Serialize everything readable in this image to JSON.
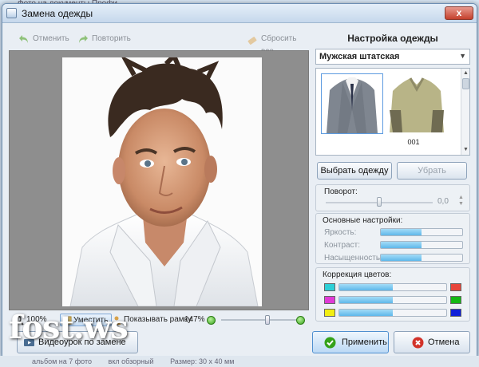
{
  "background": {
    "parent_title": "Фото на документы Профи",
    "status_left": "альбом на 7 фото",
    "status_mid": "вкл обзорный",
    "status_right": "Размер: 30 x 40 мм"
  },
  "dialog": {
    "title": "Замена одежды",
    "close_label": "x"
  },
  "toolbar": {
    "undo_label": "Отменить",
    "redo_label": "Повторить",
    "reset_label": "Сбросить все"
  },
  "zoom": {
    "percent_label": "100%",
    "fit_label": "Уместить",
    "show_frame_label": "Показывать рамку",
    "zoom_value": "147%",
    "slider_level": 0.58
  },
  "panel": {
    "title": "Настройка одежды",
    "category": "Мужская штатская",
    "items": [
      {
        "id": "001",
        "selected": true
      },
      {
        "id": "002",
        "selected": false
      }
    ],
    "choose_button": "Выбрать одежду",
    "remove_button": "Убрать"
  },
  "rotation": {
    "label": "Поворот:",
    "value": "0,0",
    "level": 0.5
  },
  "basic": {
    "label": "Основные настройки:",
    "rows": [
      {
        "name": "Яркость:",
        "level": 0.5
      },
      {
        "name": "Контраст:",
        "level": 0.5
      },
      {
        "name": "Насыщенность:",
        "level": 0.5
      }
    ]
  },
  "color_correction": {
    "label": "Коррекция цветов:",
    "rows": [
      {
        "left_color": "#2ecfd6",
        "right_color": "#e8463b",
        "level": 0.5
      },
      {
        "left_color": "#e03ad6",
        "right_color": "#14b814",
        "level": 0.5
      },
      {
        "left_color": "#f2ee12",
        "right_color": "#1020d8",
        "level": 0.5
      }
    ]
  },
  "footer": {
    "tutorial_label": "Видеоурок по замене одежды",
    "apply_label": "Применить",
    "cancel_label": "Отмена"
  },
  "watermark": "fost.ws",
  "colors": {
    "accent": "#5fb8ea",
    "apply_icon": "#35a21a",
    "cancel_icon": "#d2332a"
  }
}
